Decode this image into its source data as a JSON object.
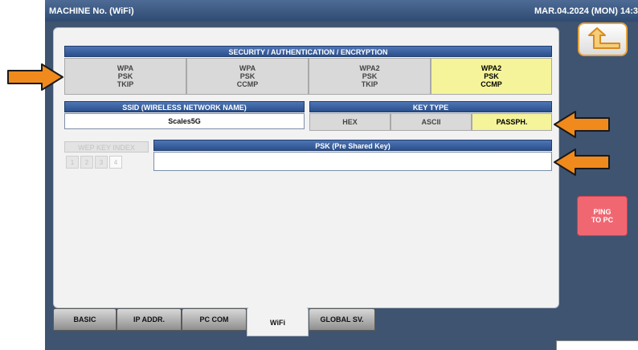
{
  "titlebar": {
    "title": "MACHINE No. (WiFi)",
    "datetime": "MAR.04.2024 (MON) 14:3"
  },
  "security": {
    "header": "SECURITY / AUTHENTICATION / ENCRYPTION",
    "options": [
      {
        "line1": "WPA",
        "line2": "PSK",
        "line3": "TKIP",
        "selected": false
      },
      {
        "line1": "WPA",
        "line2": "PSK",
        "line3": "CCMP",
        "selected": false
      },
      {
        "line1": "WPA2",
        "line2": "PSK",
        "line3": "TKIP",
        "selected": false
      },
      {
        "line1": "WPA2",
        "line2": "PSK",
        "line3": "CCMP",
        "selected": true
      }
    ]
  },
  "ssid": {
    "header": "SSID (WIRELESS NETWORK NAME)",
    "value": "Scales5G"
  },
  "key_type": {
    "header": "KEY TYPE",
    "options": [
      {
        "label": "HEX",
        "selected": false
      },
      {
        "label": "ASCII",
        "selected": false
      },
      {
        "label": "PASSPH.",
        "selected": true
      }
    ]
  },
  "wep_key_index": {
    "header": "WEP KEY INDEX",
    "options": [
      "1",
      "2",
      "3",
      "4"
    ],
    "selected": "4"
  },
  "psk": {
    "header": "PSK (Pre Shared Key)",
    "value": ""
  },
  "ping_button": {
    "line1": "PING",
    "line2": "TO PC"
  },
  "tabs": [
    {
      "label": "BASIC",
      "active": false
    },
    {
      "label": "IP ADDR.",
      "active": false
    },
    {
      "label": "PC COM",
      "active": false
    },
    {
      "label": "WiFi",
      "active": true
    },
    {
      "label": "GLOBAL SV.",
      "active": false
    }
  ],
  "colors": {
    "accent_arrow": "#f08a1c",
    "selected_option": "#f5f49a",
    "header_blue": "#2a4f8c",
    "ping_button": "#f06772"
  },
  "icons": [
    "back-arrow-icon",
    "annotation-arrow-icon"
  ]
}
